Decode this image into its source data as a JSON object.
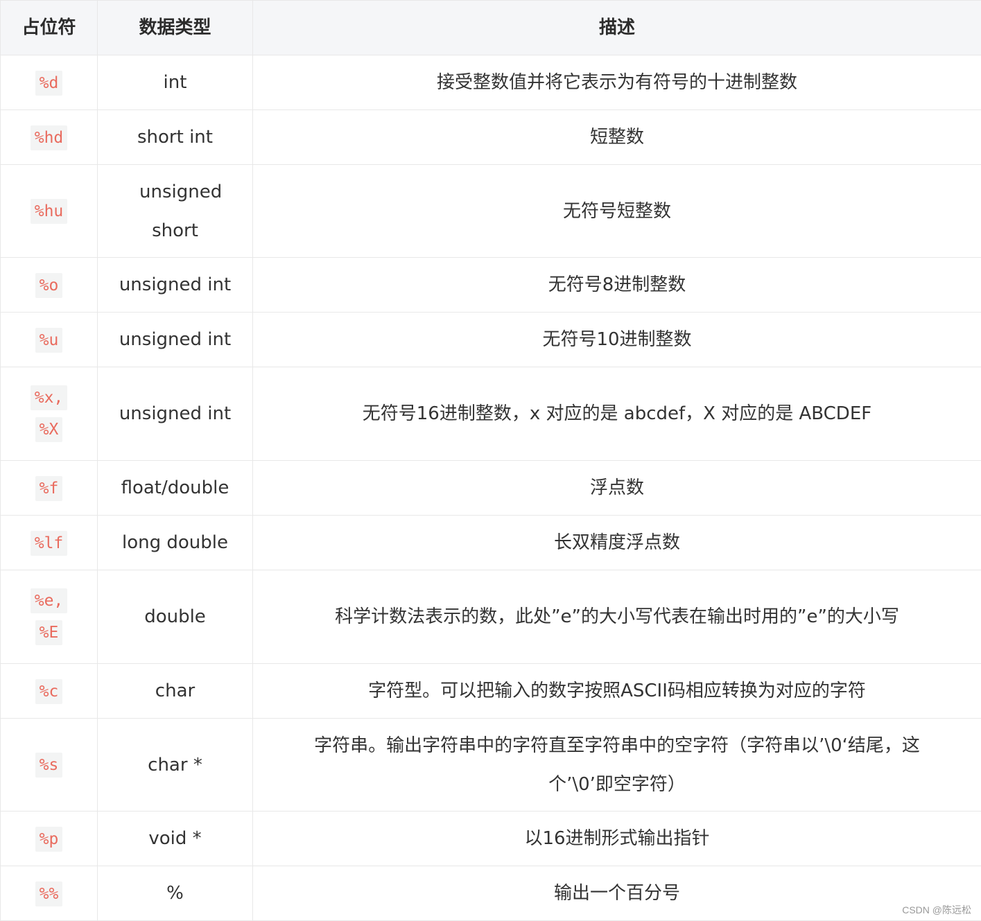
{
  "table": {
    "headers": [
      "占位符",
      "数据类型",
      "描述"
    ],
    "rows": [
      {
        "placeholders": [
          "%d"
        ],
        "type": "int",
        "desc": "接受整数值并将它表示为有符号的十进制整数"
      },
      {
        "placeholders": [
          "%hd"
        ],
        "type": "short int",
        "desc": "短整数"
      },
      {
        "placeholders": [
          "%hu"
        ],
        "type": "unsigned short",
        "desc": "无符号短整数"
      },
      {
        "placeholders": [
          "%o"
        ],
        "type": "unsigned int",
        "desc": "无符号8进制整数"
      },
      {
        "placeholders": [
          "%u"
        ],
        "type": "unsigned int",
        "desc": "无符号10进制整数"
      },
      {
        "placeholders": [
          "%x,",
          "%X"
        ],
        "type": "unsigned int",
        "desc": "无符号16进制整数，x 对应的是 abcdef，X 对应的是 ABCDEF"
      },
      {
        "placeholders": [
          "%f"
        ],
        "type": "float/double",
        "desc": "浮点数"
      },
      {
        "placeholders": [
          "%lf"
        ],
        "type": "long double",
        "desc": "长双精度浮点数"
      },
      {
        "placeholders": [
          "%e,",
          "%E"
        ],
        "type": "double",
        "desc": "科学计数法表示的数，此处”e”的大小写代表在输出时用的”e”的大小写"
      },
      {
        "placeholders": [
          "%c"
        ],
        "type": "char",
        "desc": "字符型。可以把输入的数字按照ASCII码相应转换为对应的字符"
      },
      {
        "placeholders": [
          "%s"
        ],
        "type": "char *",
        "desc": "字符串。输出字符串中的字符直至字符串中的空字符（字符串以’\\0‘结尾，这个’\\0’即空字符）"
      },
      {
        "placeholders": [
          "%p"
        ],
        "type": "void *",
        "desc": "以16进制形式输出指针"
      },
      {
        "placeholders": [
          "%%"
        ],
        "type": "%",
        "desc": "输出一个百分号"
      }
    ]
  },
  "watermark": "CSDN @陈远松"
}
